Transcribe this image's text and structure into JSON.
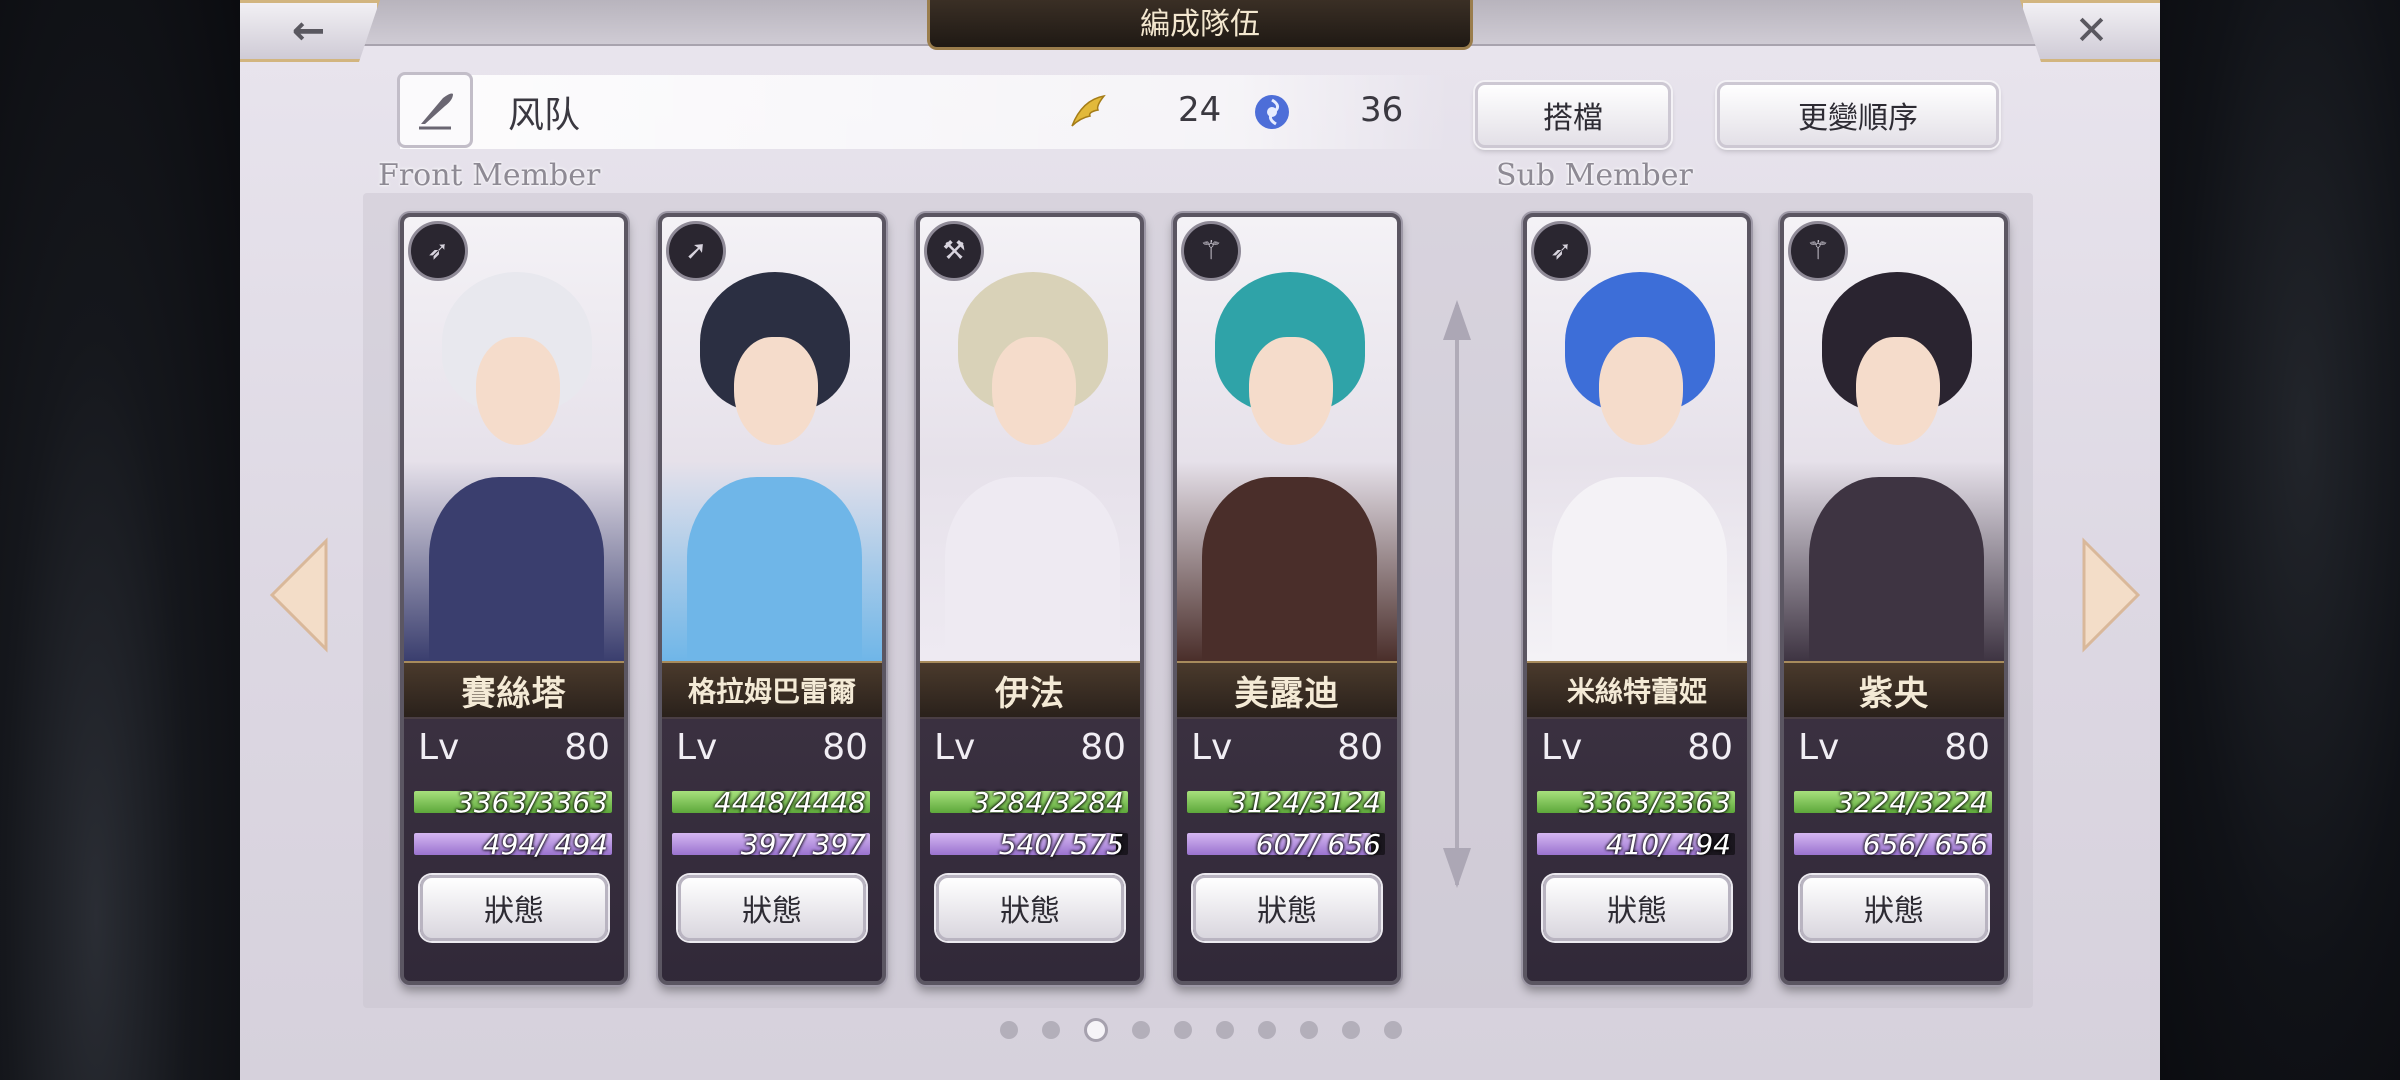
{
  "header": {
    "title": "編成隊伍",
    "back_icon": "←",
    "close_icon": "✕"
  },
  "team": {
    "name": "风队",
    "wing_value": "24",
    "orb_value": "36"
  },
  "buttons": {
    "partner": "搭檔",
    "reorder": "更變順序"
  },
  "sections": {
    "front": "Front Member",
    "sub": "Sub Member"
  },
  "members": [
    {
      "name": "賽絲塔",
      "lv_label": "Lv",
      "lv": "80",
      "hp_text": "3363/3363",
      "hp": 1.0,
      "sp_text": "494/ 494",
      "sp": 1.0,
      "status": "狀態",
      "class_icon": "bow-icon",
      "hair": "#e8e8ee",
      "outfit": "#3a3e6e"
    },
    {
      "name": "格拉姆巴雷爾",
      "lv_label": "Lv",
      "lv": "80",
      "hp_text": "4448/4448",
      "hp": 1.0,
      "sp_text": "397/ 397",
      "sp": 1.0,
      "status": "狀態",
      "class_icon": "spear-icon",
      "hair": "#2b2f42",
      "outfit": "#6fb6e8"
    },
    {
      "name": "伊法",
      "lv_label": "Lv",
      "lv": "80",
      "hp_text": "3284/3284",
      "hp": 1.0,
      "sp_text": "540/ 575",
      "sp": 0.94,
      "status": "狀態",
      "class_icon": "hammer-icon",
      "hair": "#d9d2b8",
      "outfit": "#eeeaf2"
    },
    {
      "name": "美露迪",
      "lv_label": "Lv",
      "lv": "80",
      "hp_text": "3124/3124",
      "hp": 1.0,
      "sp_text": "607/ 656",
      "sp": 0.93,
      "status": "狀態",
      "class_icon": "staff-icon",
      "hair": "#2fa3a8",
      "outfit": "#4a2e2a"
    },
    {
      "name": "米絲特蕾婭",
      "lv_label": "Lv",
      "lv": "80",
      "hp_text": "3363/3363",
      "hp": 1.0,
      "sp_text": "410/ 494",
      "sp": 0.83,
      "status": "狀態",
      "class_icon": "bow-icon",
      "hair": "#3d6ed8",
      "outfit": "#f4f2f6"
    },
    {
      "name": "紫央",
      "lv_label": "Lv",
      "lv": "80",
      "hp_text": "3224/3224",
      "hp": 1.0,
      "sp_text": "656/ 656",
      "sp": 1.0,
      "status": "狀態",
      "class_icon": "staff-icon",
      "hair": "#2a2430",
      "outfit": "#3e3442"
    }
  ],
  "pagination": {
    "count": 10,
    "active": 2
  }
}
